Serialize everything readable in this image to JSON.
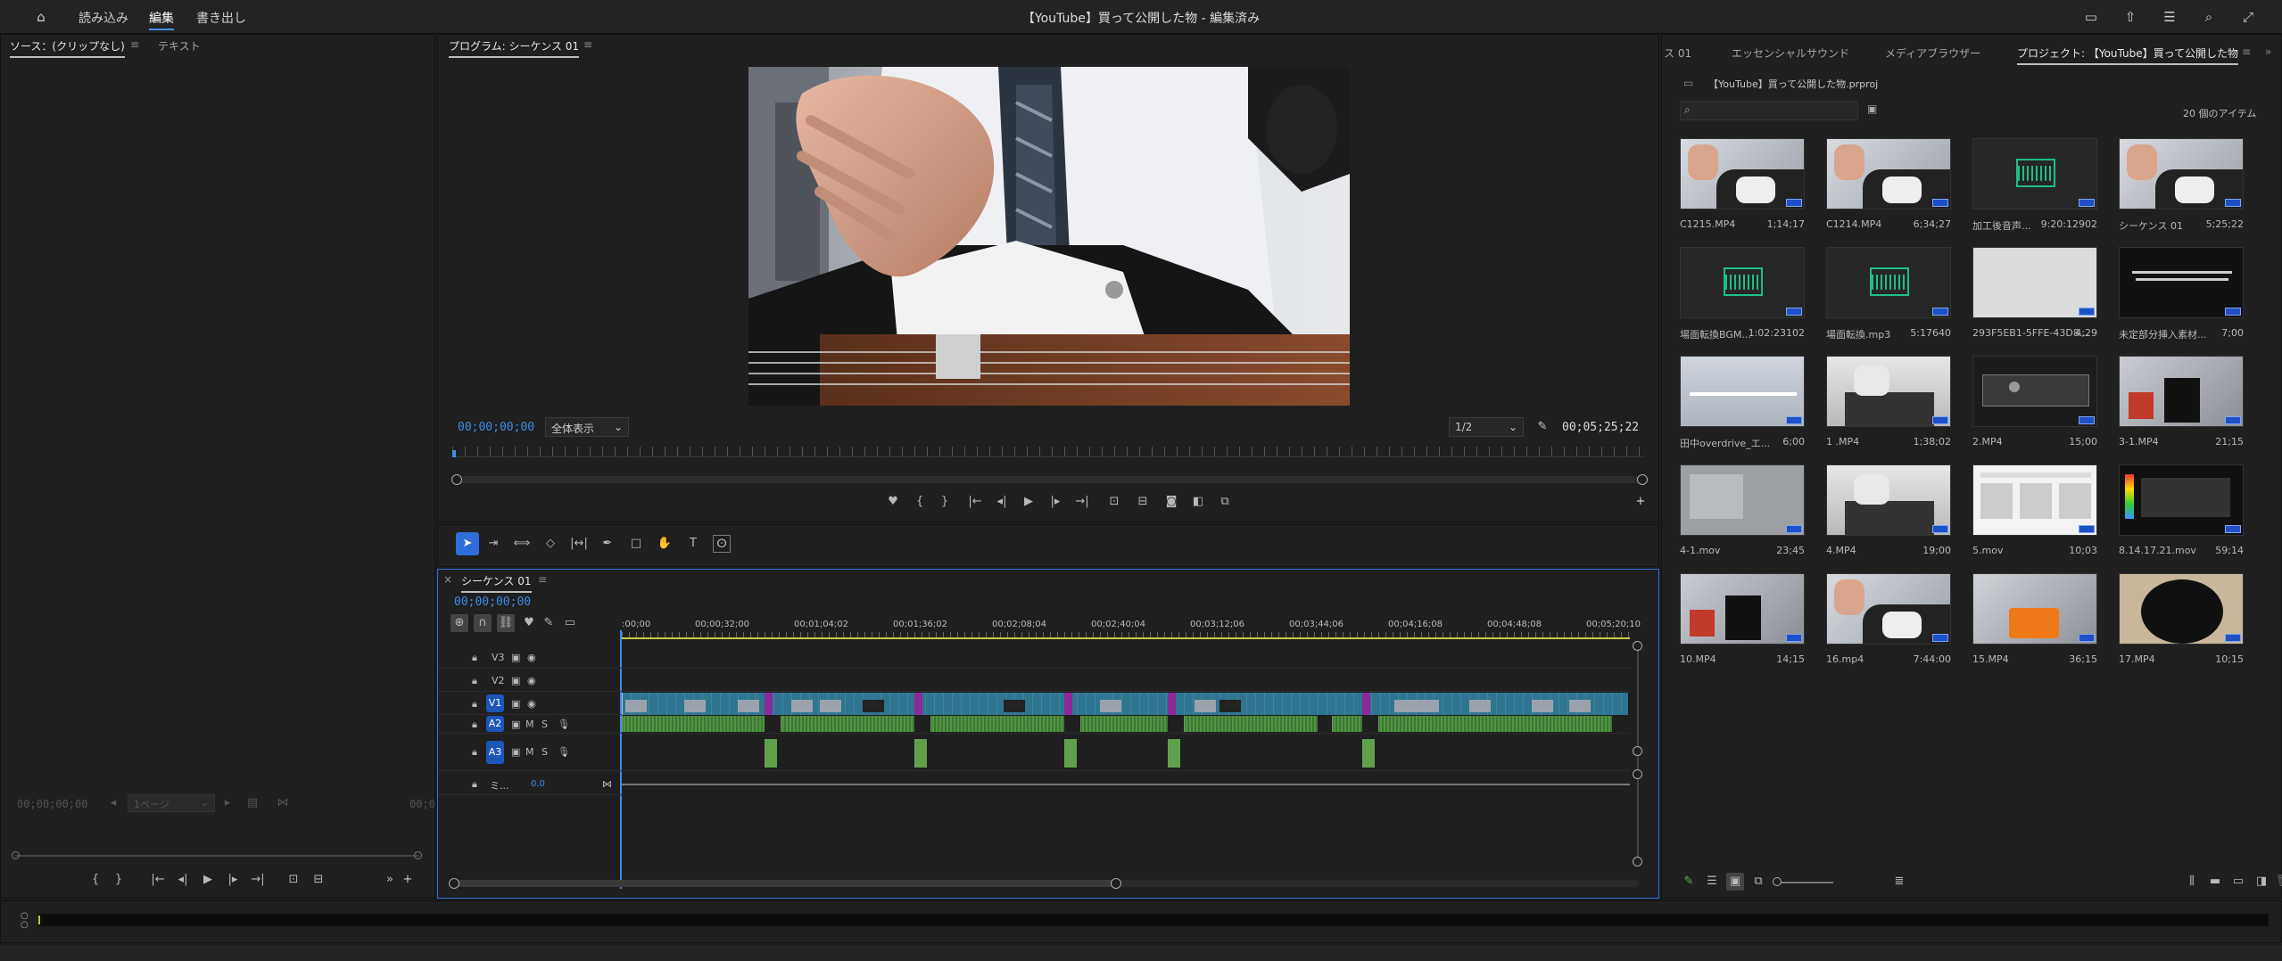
{
  "topbar": {
    "home_icon": "home-icon",
    "workspaces": [
      "読み込み",
      "編集",
      "書き出し"
    ],
    "active_workspace": "編集",
    "title": "【YouTube】買って公開した物 - 編集済み"
  },
  "source_panel": {
    "tabs": [
      "ソース：(クリップなし)",
      "テキスト"
    ],
    "timecode_left": "00;00;00;00",
    "page_select": "1ページ",
    "timecode_right": "00;0"
  },
  "program": {
    "tab": "プログラム: シーケンス 01",
    "timecode": "00;00;00;00",
    "zoom": "全体表示",
    "resolution": "1/2",
    "duration": "00;05;25;22"
  },
  "tools": [
    "selection-tool",
    "track-select-tool",
    "ripple-edit-tool",
    "razor-tool",
    "slip-tool",
    "pen-tool",
    "rectangle-tool",
    "hand-tool",
    "type-tool",
    "caption-tool"
  ],
  "timeline": {
    "tab": "シーケンス 01",
    "timecode": "00;00;00;00",
    "ruler": [
      ":00;00",
      "00;00;32;00",
      "00;01;04;02",
      "00;01;36;02",
      "00;02;08;04",
      "00;02;40;04",
      "00;03;12;06",
      "00;03;44;06",
      "00;04;16;08",
      "00;04;48;08",
      "00;05;20;10"
    ],
    "tracks": [
      {
        "name": "V3"
      },
      {
        "name": "V2"
      },
      {
        "name": "V1"
      },
      {
        "name": "A2",
        "m": "M",
        "s": "S"
      },
      {
        "name": "A3",
        "m": "M",
        "s": "S"
      },
      {
        "name": "ミ...",
        "vol": "0.0"
      }
    ]
  },
  "project": {
    "tabs": [
      "ス 01",
      "エッセンシャルサウンド",
      "メディアブラウザー",
      "プロジェクト: 【YouTube】買って公開した物"
    ],
    "file": "【YouTube】買って公開した物.prproj",
    "count": "20 個のアイテム",
    "items": [
      {
        "name": "C1215.MP4",
        "dur": "1;14;17",
        "kind": "gtr"
      },
      {
        "name": "C1214.MP4",
        "dur": "6;34;27",
        "kind": "gtr"
      },
      {
        "name": "加工後音声...",
        "dur": "9:20:12902",
        "kind": "audio"
      },
      {
        "name": "シーケンス 01",
        "dur": "5;25;22",
        "kind": "gtr"
      },
      {
        "name": "場面転換BGM...",
        "dur": "1:02:23102",
        "kind": "audio"
      },
      {
        "name": "場面転換.mp3",
        "dur": "5:17640",
        "kind": "audio"
      },
      {
        "name": "293F5EB1-5FFE-43D8...",
        "dur": "4;29",
        "kind": "light"
      },
      {
        "name": "未定部分挿入素材...",
        "dur": "7;00",
        "kind": "dark"
      },
      {
        "name": "田中overdrive_エ...",
        "dur": "6;00",
        "kind": "light2"
      },
      {
        "name": "1 .MP4",
        "dur": "1;38;02",
        "kind": "desk"
      },
      {
        "name": "2.MP4",
        "dur": "15;00",
        "kind": "gear"
      },
      {
        "name": "3-1.MP4",
        "dur": "21;15",
        "kind": "red"
      },
      {
        "name": "4-1.mov",
        "dur": "23;45",
        "kind": "grey"
      },
      {
        "name": "4.MP4",
        "dur": "19;00",
        "kind": "desk"
      },
      {
        "name": "5.mov",
        "dur": "10;03",
        "kind": "web"
      },
      {
        "name": "8.14.17.21.mov",
        "dur": "59;14",
        "kind": "screen"
      },
      {
        "name": "10.MP4",
        "dur": "14;15",
        "kind": "red"
      },
      {
        "name": "16.mp4",
        "dur": "7:44:00",
        "kind": "gtr"
      },
      {
        "name": "15.MP4",
        "dur": "36;15",
        "kind": "pedal"
      },
      {
        "name": "17.MP4",
        "dur": "10;15",
        "kind": "hole"
      }
    ]
  },
  "colors": {
    "accent": "#3e8de8",
    "video_clip": "#2f7590",
    "audio_clip": "#1c3d2a",
    "marker": "#8c2a9a"
  }
}
